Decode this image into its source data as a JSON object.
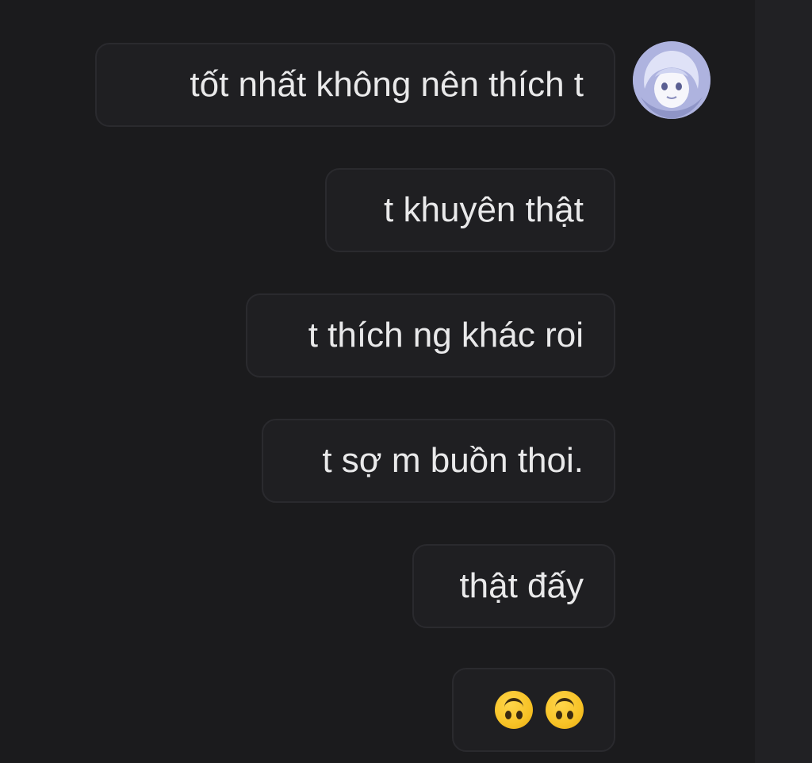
{
  "conversation": {
    "messages": [
      {
        "text": "tốt nhất không nên thích t"
      },
      {
        "text": "t khuyên thật"
      },
      {
        "text": "t thích ng khác roi"
      },
      {
        "text": "t sợ m buồn thoi."
      },
      {
        "text": "thật đấy"
      },
      {
        "emojis": [
          "upside-down-face-icon",
          "upside-down-face-icon"
        ]
      }
    ],
    "avatar": {
      "icon": "anime-girl-avatar"
    }
  },
  "colors": {
    "background": "#1b1b1d",
    "bubble_border": "#2a2a2e",
    "text": "#e9e9ea",
    "emoji": "#f7c226"
  }
}
